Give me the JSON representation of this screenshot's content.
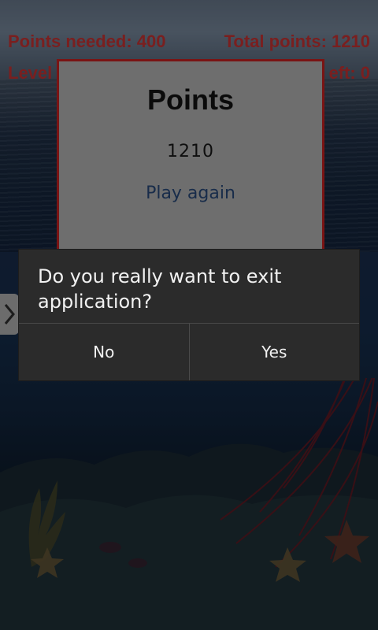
{
  "hud": {
    "points_needed": "Points needed: 400",
    "total_points": "Total points: 1210",
    "level_partial": "Level",
    "moves_left_partial": "eft: 0"
  },
  "points_panel": {
    "title": "Points",
    "value": "1210",
    "play_again": "Play again"
  },
  "dialog": {
    "message": "Do you really want to exit application?",
    "no_label": "No",
    "yes_label": "Yes"
  },
  "side_tab": {
    "icon": "chevron-right-icon"
  },
  "colors": {
    "hud_text": "#7a1f1f",
    "panel_border": "#7a1414",
    "dialog_bg": "#2b2b2b",
    "play_again": "#182c4a"
  }
}
